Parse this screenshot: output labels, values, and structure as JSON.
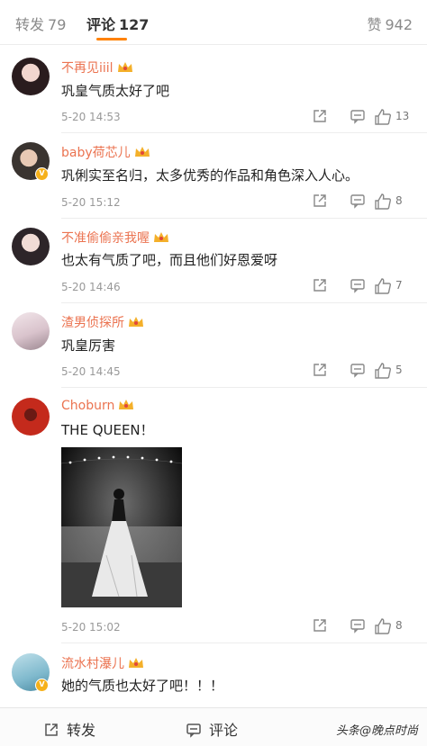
{
  "tabs": {
    "repost": {
      "label": "转发",
      "count": "79"
    },
    "comment": {
      "label": "评论",
      "count": "127"
    },
    "like": {
      "label": "赞",
      "count": "942"
    }
  },
  "comments": [
    {
      "username": "不再见iiil",
      "text": "巩皇气质太好了吧",
      "time": "5-20 14:53",
      "likes": "13",
      "verified": false
    },
    {
      "username": "baby荷芯儿",
      "text": "巩俐实至名归，太多优秀的作品和角色深入人心。",
      "time": "5-20 15:12",
      "likes": "8",
      "verified": true
    },
    {
      "username": "不准偷偷亲我喔",
      "text": "也太有气质了吧，而且他们好恩爱呀",
      "time": "5-20 14:46",
      "likes": "7",
      "verified": false
    },
    {
      "username": "渣男侦探所",
      "text": "巩皇厉害",
      "time": "5-20 14:45",
      "likes": "5",
      "verified": false
    },
    {
      "username": "Choburn",
      "text": "THE QUEEN！",
      "time": "5-20 15:02",
      "likes": "8",
      "verified": false
    },
    {
      "username": "流水村瀑儿",
      "text": "她的气质也太好了吧！！！",
      "time": "",
      "likes": "",
      "verified": true
    }
  ],
  "bottom_bar": {
    "repost": "转发",
    "comment": "评论",
    "watermark": "头条@晚点时尚"
  },
  "colors": {
    "accent": "#ff8200",
    "username": "#eb7350",
    "badge": "#f6b11b"
  }
}
